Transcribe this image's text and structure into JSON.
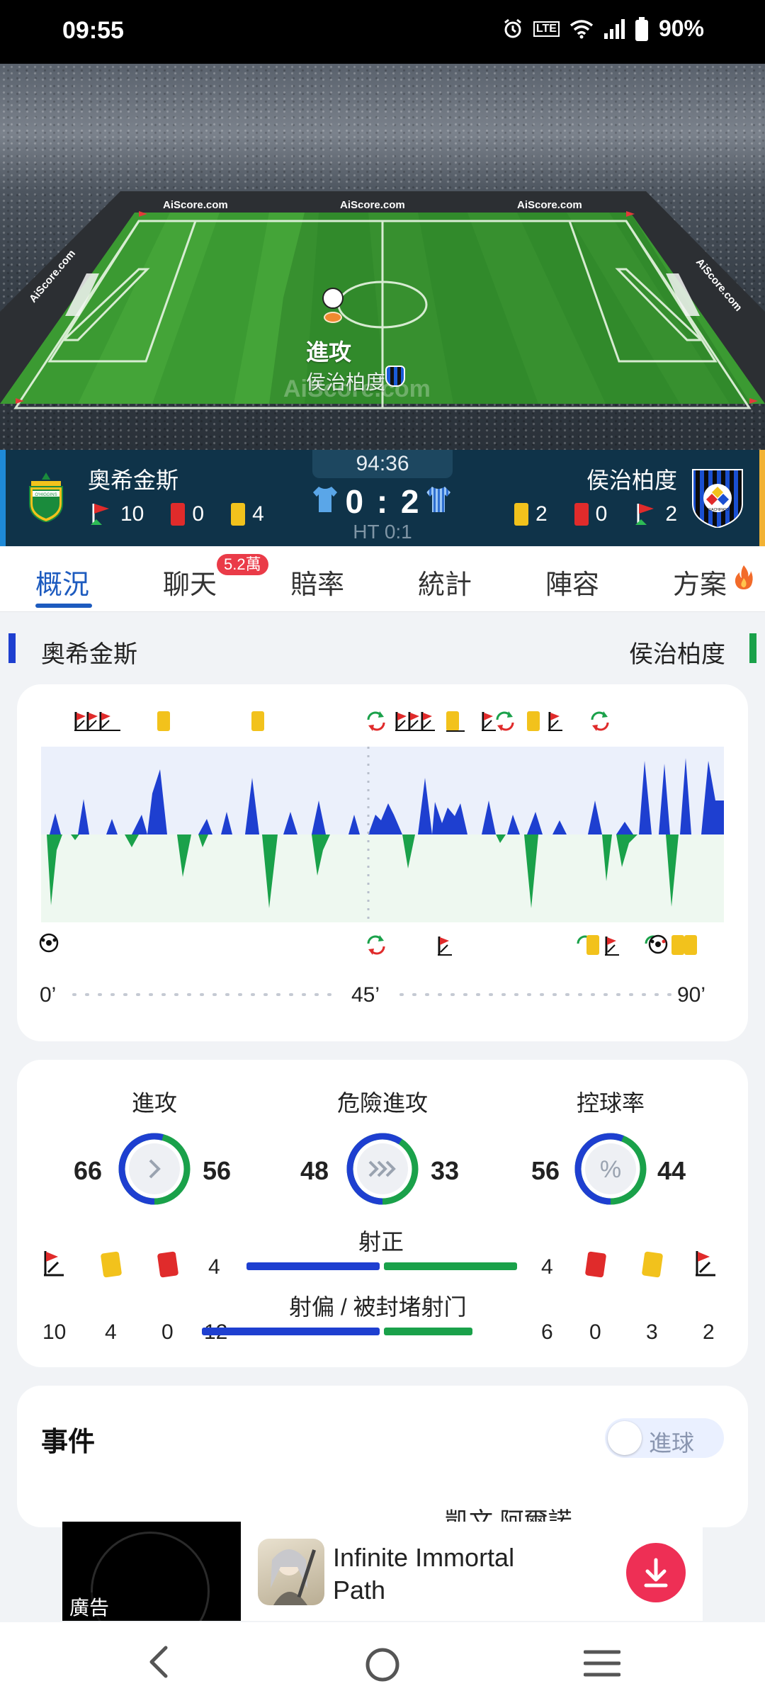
{
  "status_bar": {
    "time": "09:55",
    "battery": "90%",
    "network": "LTE"
  },
  "pitch": {
    "ad_boards": [
      "AiScore.com",
      "AiScore.com",
      "AiScore.com",
      "AiScore.com",
      "AiScore.com"
    ],
    "watermark": "AiScore.com",
    "event_title": "進攻",
    "event_team": "侯治柏度"
  },
  "match": {
    "timer": "94:36",
    "score": "0 : 2",
    "half_time": "HT 0:1",
    "home": {
      "name": "奧希金斯",
      "logo_text": "O'HIGGINS",
      "corners": "10",
      "red_cards": "0",
      "yellow_cards": "4",
      "color": "#1e3fd0"
    },
    "away": {
      "name": "侯治柏度",
      "logo_text": "HUACHIPATO",
      "corners": "2",
      "red_cards": "0",
      "yellow_cards": "2",
      "color": "#1aa14a"
    }
  },
  "tabs": [
    {
      "label": "概況",
      "active": true
    },
    {
      "label": "聊天",
      "badge": "5.2萬"
    },
    {
      "label": "賠率"
    },
    {
      "label": "統計"
    },
    {
      "label": "陣容"
    },
    {
      "label": "方案",
      "icon": "fire-icon"
    }
  ],
  "team_row": {
    "home": "奧希金斯",
    "away": "侯治柏度"
  },
  "timeline": {
    "start": "0’",
    "mid": "45’",
    "end": "90’"
  },
  "stats": {
    "attack": {
      "label": "進攻",
      "home": 66,
      "away": 56
    },
    "dangerous_attack": {
      "label": "危險進攻",
      "home": 48,
      "away": 33
    },
    "possession": {
      "label": "控球率",
      "home": 56,
      "away": 44,
      "icon": "%"
    },
    "shots_on_target": {
      "label": "射正",
      "home": 4,
      "away": 4
    },
    "shots_off": {
      "label": "射偏 / 被封堵射门",
      "home": 12,
      "away": 6
    },
    "home_counts": {
      "corners": "10",
      "yellow": "4",
      "red": "0"
    },
    "away_counts": {
      "red": "0",
      "yellow": "3",
      "corners": "2"
    }
  },
  "events": {
    "title": "事件",
    "toggle_label": "進球",
    "peek_text": "凱文 阿爾諾"
  },
  "ad": {
    "label": "廣告",
    "app_name": "Infinite Immortal Path"
  }
}
